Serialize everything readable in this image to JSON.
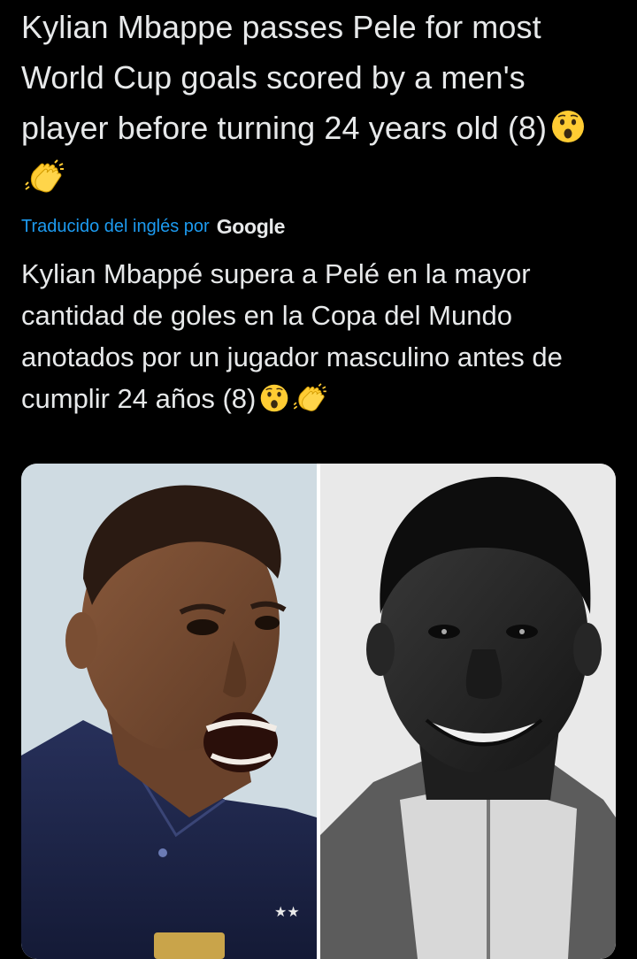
{
  "tweet": {
    "original_text": "Kylian Mbappe passes Pele for most World Cup goals scored by a men's player before turning 24 years old (8)",
    "translation_label": "Traducido del inglés por",
    "translation_provider": "Google",
    "translated_text": "Kylian Mbappé supera a Pelé en la mayor cantidad de goles en la Copa del Mundo anotados por un jugador masculino antes de cumplir 24 años (8)",
    "emojis": [
      "astonished-face-emoji",
      "clapping-hands-emoji"
    ]
  },
  "colors": {
    "background": "#000000",
    "text": "#e7e9ea",
    "link": "#1d9bf0"
  },
  "media": {
    "images": [
      {
        "name": "mbappe-photo",
        "style": "color"
      },
      {
        "name": "pele-photo",
        "style": "black-and-white"
      }
    ]
  }
}
